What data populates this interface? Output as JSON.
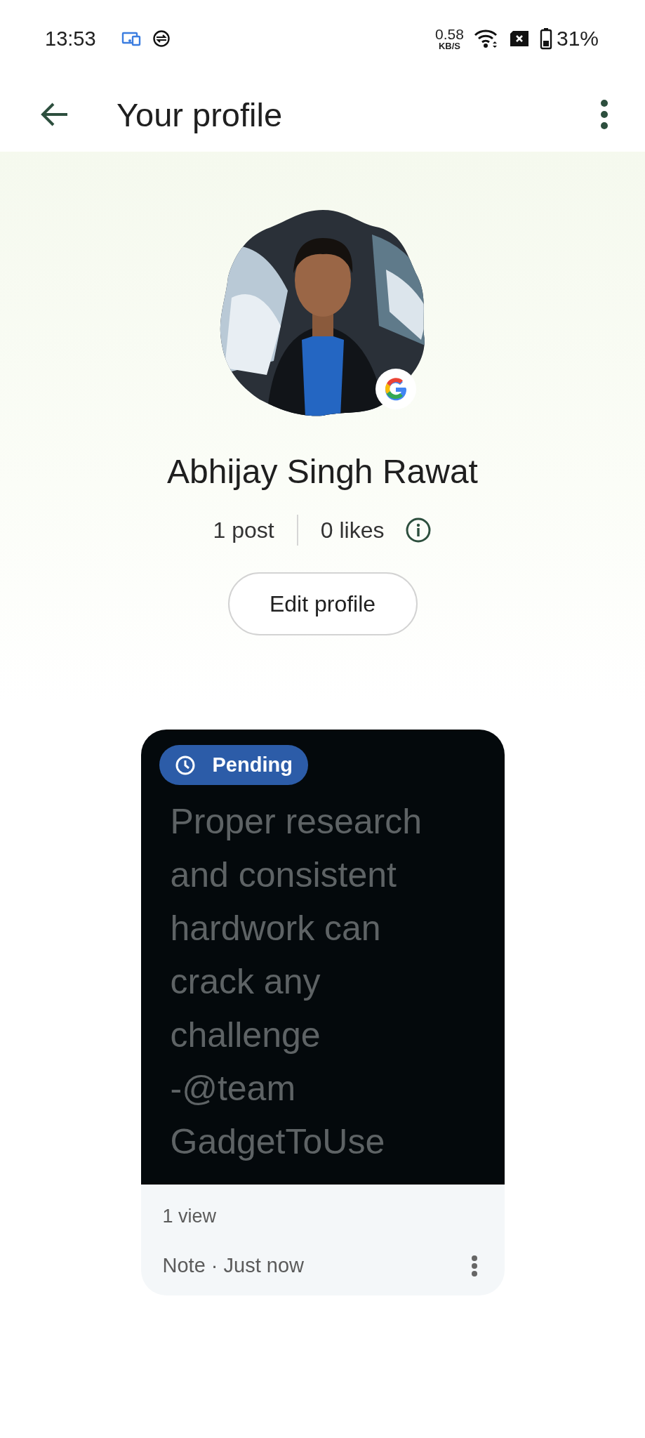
{
  "status_bar": {
    "time": "13:53",
    "speed": "0.58",
    "speed_unit": "KB/S",
    "battery": "31%"
  },
  "app_bar": {
    "title": "Your profile"
  },
  "profile": {
    "name": "Abhijay Singh Rawat",
    "posts": "1 post",
    "likes": "0 likes",
    "edit_button": "Edit profile"
  },
  "post": {
    "badge": "Pending",
    "lines": [
      "Proper research",
      "and consistent",
      "hardwork can",
      "crack any",
      "challenge",
      "-@team",
      "GadgetToUse"
    ],
    "views": "1 view",
    "meta": "Note · Just now"
  }
}
